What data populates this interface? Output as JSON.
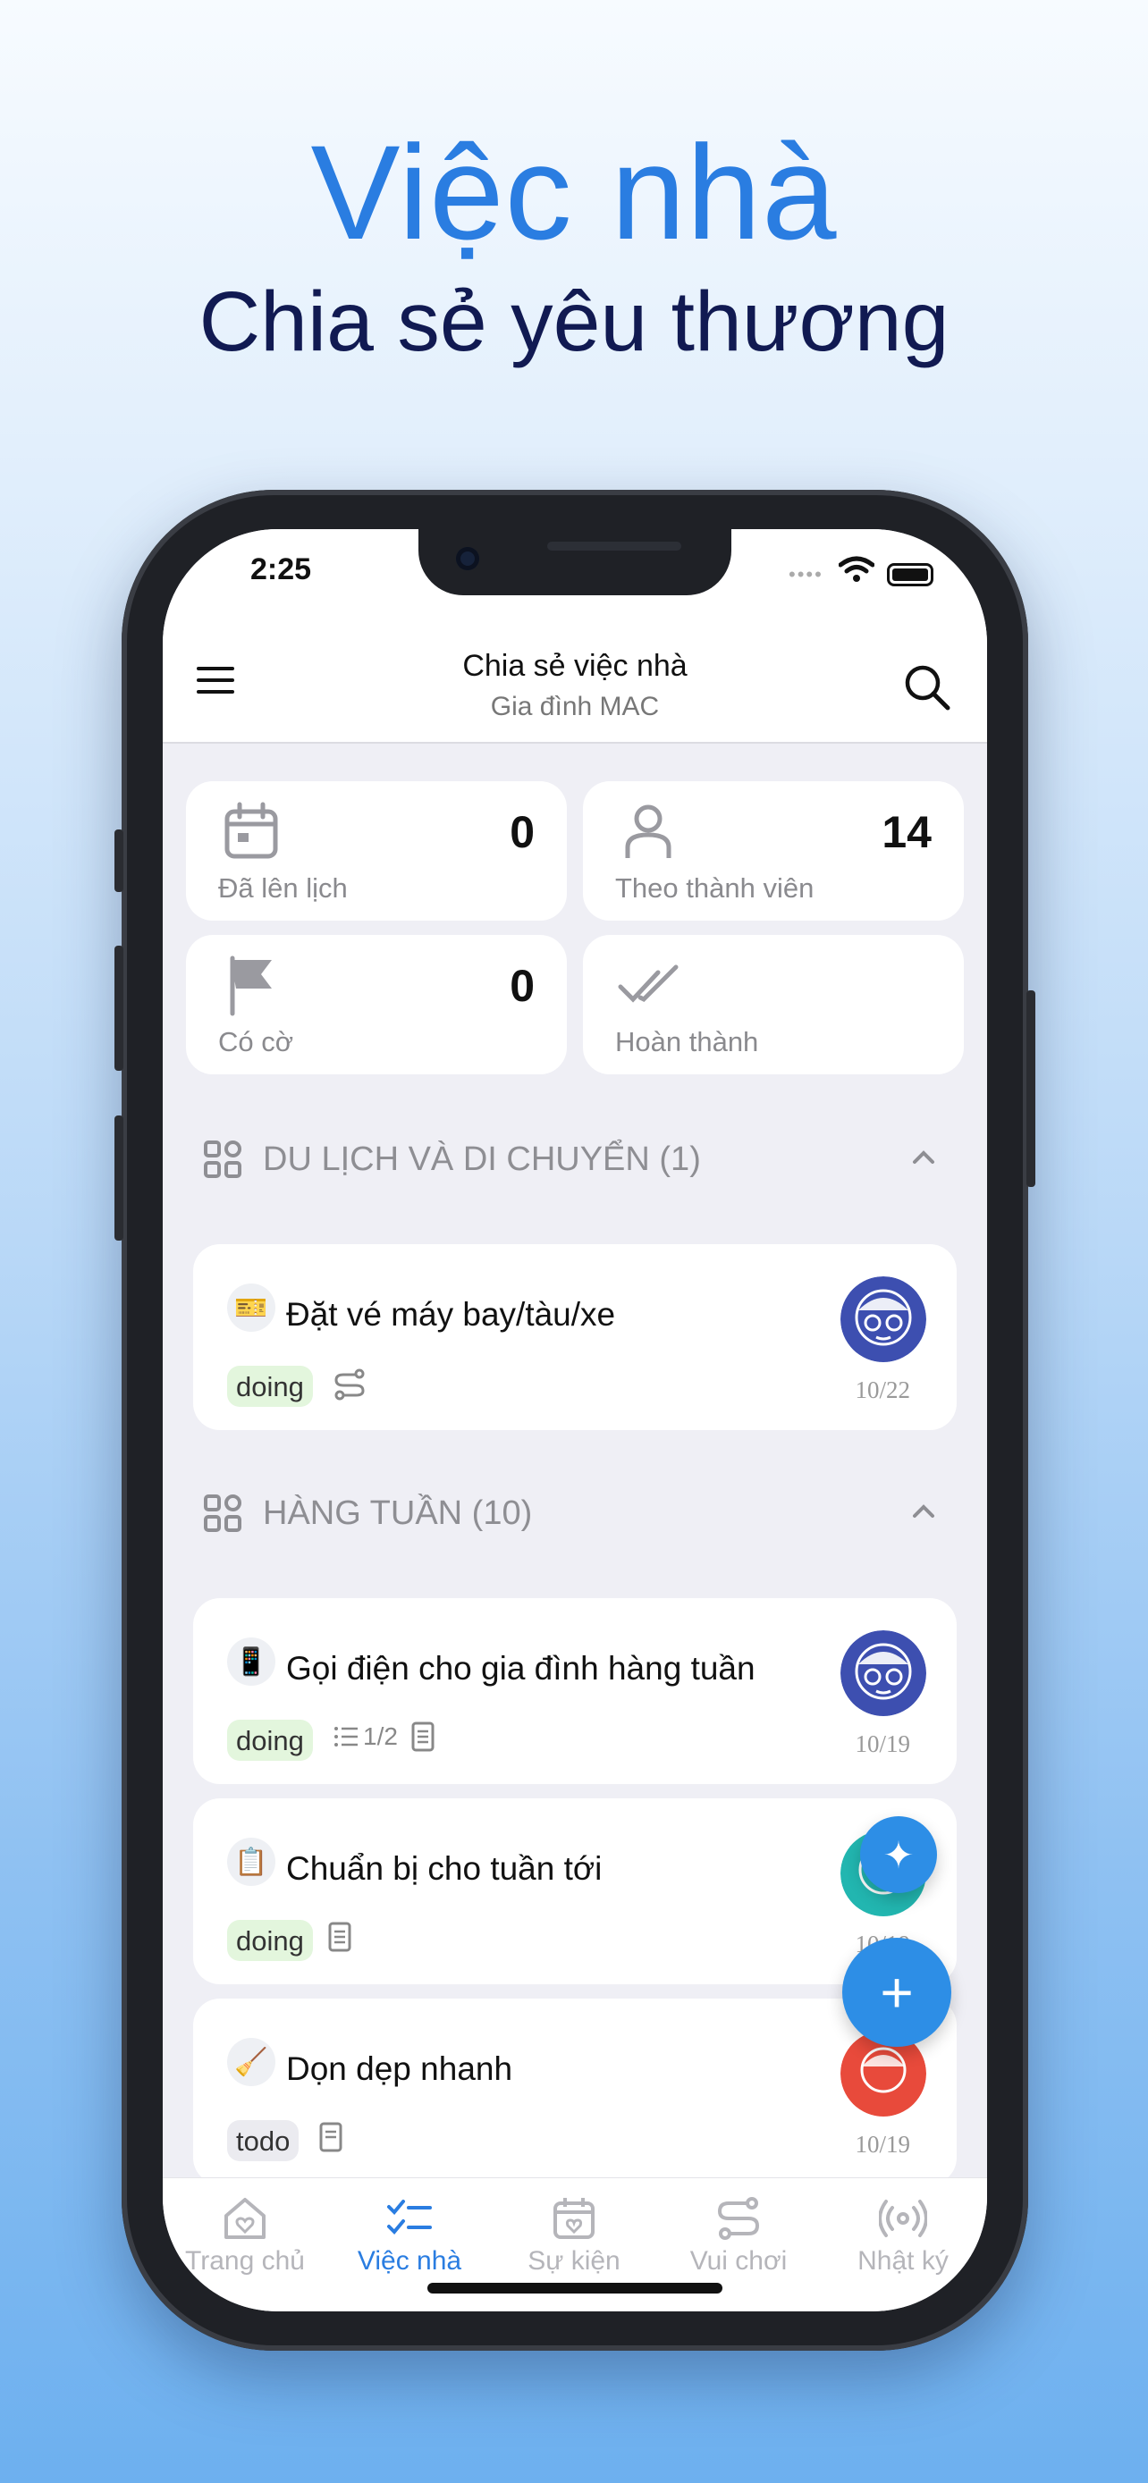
{
  "hero": {
    "title": "Việc nhà",
    "subtitle": "Chia sẻ yêu thương"
  },
  "status_bar": {
    "time": "2:25"
  },
  "header": {
    "title": "Chia sẻ việc nhà",
    "subtitle": "Gia đình MAC"
  },
  "stats": [
    {
      "label": "Đã lên lịch",
      "count": "0",
      "icon": "calendar-icon"
    },
    {
      "label": "Theo thành viên",
      "count": "14",
      "icon": "person-icon"
    },
    {
      "label": "Có cờ",
      "count": "0",
      "icon": "flag-icon"
    },
    {
      "label": "Hoàn thành",
      "count": "",
      "icon": "double-check-icon"
    }
  ],
  "sections": [
    {
      "title": "DU LỊCH VÀ DI CHUYỂN (1)",
      "tasks": [
        {
          "title": "Đặt vé máy bay/tàu/xe",
          "status": "doing",
          "meta": "",
          "date": "10/22",
          "emoji": "🎫",
          "avatar_color": "#3d4fb0"
        }
      ]
    },
    {
      "title": "HÀNG TUẦN (10)",
      "tasks": [
        {
          "title": "Gọi điện cho gia đình hàng tuần",
          "status": "doing",
          "meta": "1/2",
          "date": "10/19",
          "emoji": "📱",
          "avatar_color": "#3d4fb0"
        },
        {
          "title": "Chuẩn bị cho tuần tới",
          "status": "doing",
          "meta": "",
          "date": "10/19",
          "emoji": "📋",
          "avatar_color": "#22b6b0"
        },
        {
          "title": "Dọn dẹp nhanh",
          "status": "todo",
          "meta": "",
          "date": "10/19",
          "emoji": "🧹",
          "avatar_color": "#e84a3b"
        }
      ]
    }
  ],
  "fab": {
    "add": "+",
    "ai": "✦"
  },
  "tabs": [
    {
      "label": "Trang chủ",
      "icon": "home-heart-icon",
      "active": false
    },
    {
      "label": "Việc nhà",
      "icon": "checklist-icon",
      "active": true
    },
    {
      "label": "Sự kiện",
      "icon": "calendar-heart-icon",
      "active": false
    },
    {
      "label": "Vui chơi",
      "icon": "route-icon",
      "active": false
    },
    {
      "label": "Nhật ký",
      "icon": "broadcast-icon",
      "active": false
    }
  ],
  "colors": {
    "accent": "#2a7de1",
    "hero_title": "#2a7de1",
    "hero_subtitle": "#111a52",
    "doing_tag": "#e3f6dd"
  }
}
